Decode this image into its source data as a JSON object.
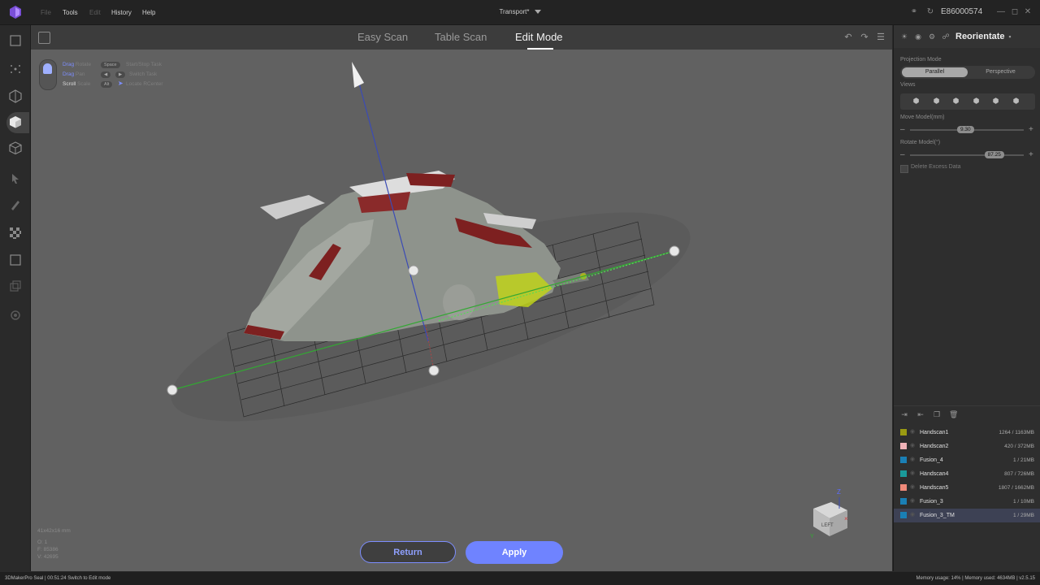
{
  "titlebar": {
    "menus": [
      "File",
      "Tools",
      "Edit",
      "History",
      "Help"
    ],
    "document_title": "Transport*",
    "device_id": "E86000574"
  },
  "topnav": {
    "tabs": [
      "Easy Scan",
      "Table Scan",
      "Edit Mode"
    ],
    "active_tab": "Edit Mode"
  },
  "hints": {
    "rows": [
      {
        "action": "Drag",
        "effect": "Rotate",
        "key": "Space",
        "key_effect": "Start/Stop Task"
      },
      {
        "action": "Drag",
        "effect": "Pan",
        "key": "",
        "key_effect": "Switch Task"
      },
      {
        "action": "Scroll",
        "effect": "Scale",
        "key": "Alt",
        "key_effect": "Locate RCenter"
      }
    ]
  },
  "model_info": {
    "dimensions": "41x42x16 mm",
    "o": "O: 1",
    "f": "F: 85386",
    "v": "V: 42695"
  },
  "actions": {
    "return_label": "Return",
    "apply_label": "Apply"
  },
  "orientation_cube": {
    "face": "LEFT",
    "axis_z": "Z"
  },
  "panel": {
    "title": "Reorientate",
    "projection_mode_label": "Projection Mode",
    "projection_options": [
      "Parallel",
      "Perspective"
    ],
    "projection_selected": "Parallel",
    "views_label": "Views",
    "move_label": "Move Model(mm)",
    "move_value": "9.30",
    "move_fraction": 0.5,
    "rotate_label": "Rotate Model(°)",
    "rotate_value": "87.25",
    "rotate_fraction": 0.74,
    "delete_excess_label": "Delete Excess Data"
  },
  "layers": [
    {
      "name": "Handscan1",
      "size": "1264 / 1163MB",
      "color": "#9a9a12",
      "selected": false
    },
    {
      "name": "Handscan2",
      "size": "420 / 372MB",
      "color": "#f0b3b8",
      "selected": false
    },
    {
      "name": "Fusion_4",
      "size": "1 / 21MB",
      "color": "#1a7fb5",
      "selected": false
    },
    {
      "name": "Handscan4",
      "size": "807 / 726MB",
      "color": "#1a9a9a",
      "selected": false
    },
    {
      "name": "Handscan5",
      "size": "1807 / 1662MB",
      "color": "#f08a7a",
      "selected": false
    },
    {
      "name": "Fusion_3",
      "size": "1 / 10MB",
      "color": "#1a7fb5",
      "selected": false
    },
    {
      "name": "Fusion_3_TM",
      "size": "1 / 29MB",
      "color": "#1a7fb5",
      "selected": true
    }
  ],
  "statusbar": {
    "left": "3DMakerPro Seal  |  00:51:24 Switch to Edit mode",
    "right": "Memory usage: 14% | Memory used: 4634MB | v2.5.15"
  }
}
